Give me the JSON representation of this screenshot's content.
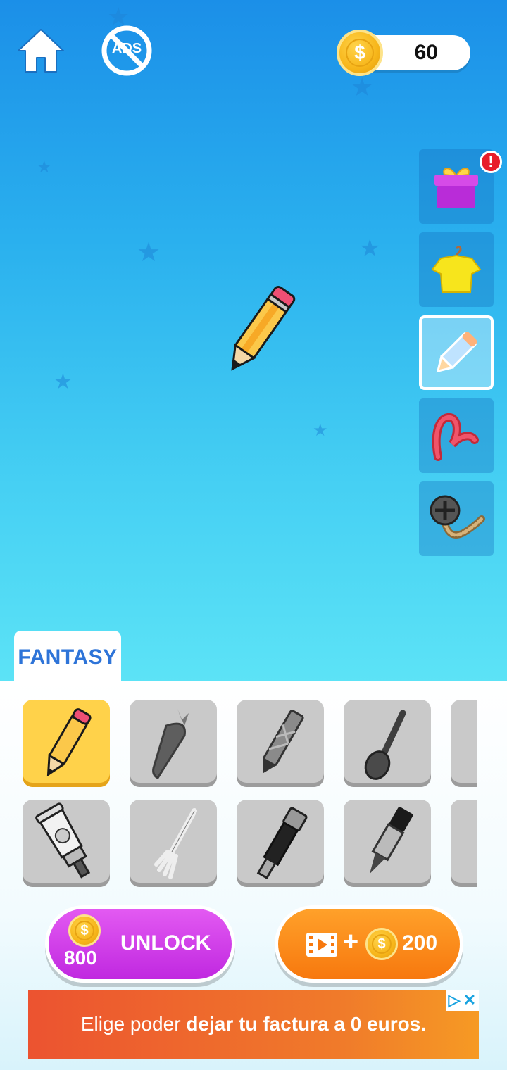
{
  "header": {
    "home_icon": "home-icon",
    "no_ads_label": "ADS",
    "coins": "60"
  },
  "side_tabs": [
    {
      "name": "gift",
      "icon": "gift-icon",
      "alert": "!"
    },
    {
      "name": "shirt",
      "icon": "shirt-icon"
    },
    {
      "name": "pencil",
      "icon": "pencil-icon",
      "active": true
    },
    {
      "name": "trail",
      "icon": "trail-icon"
    },
    {
      "name": "wheel",
      "icon": "wheel-trail-icon"
    }
  ],
  "category_tab": "FANTASY",
  "items": [
    {
      "icon": "pencil-icon",
      "selected": true
    },
    {
      "icon": "carrot-icon"
    },
    {
      "icon": "pen-icon"
    },
    {
      "icon": "spoon-icon"
    },
    {
      "icon": "knife-icon"
    },
    {
      "icon": "glue-tube-icon"
    },
    {
      "icon": "fork-icon"
    },
    {
      "icon": "telescope-icon"
    },
    {
      "icon": "marker-icon"
    },
    {
      "icon": "partial-icon"
    }
  ],
  "unlock_button": {
    "cost": "800",
    "label": "UNLOCK",
    "currency": "$"
  },
  "video_button": {
    "plus": "+",
    "reward": "200",
    "currency": "$"
  },
  "ad": {
    "text_regular": "Elige poder ",
    "text_bold": "dejar tu factura a 0 euros."
  },
  "colors": {
    "sky_top": "#1b8fe8",
    "sky_bottom": "#5ce3f6",
    "tab_text": "#2e74d8",
    "unlock": "#c028e0",
    "video": "#f7780e",
    "ad": "#ec5330"
  }
}
